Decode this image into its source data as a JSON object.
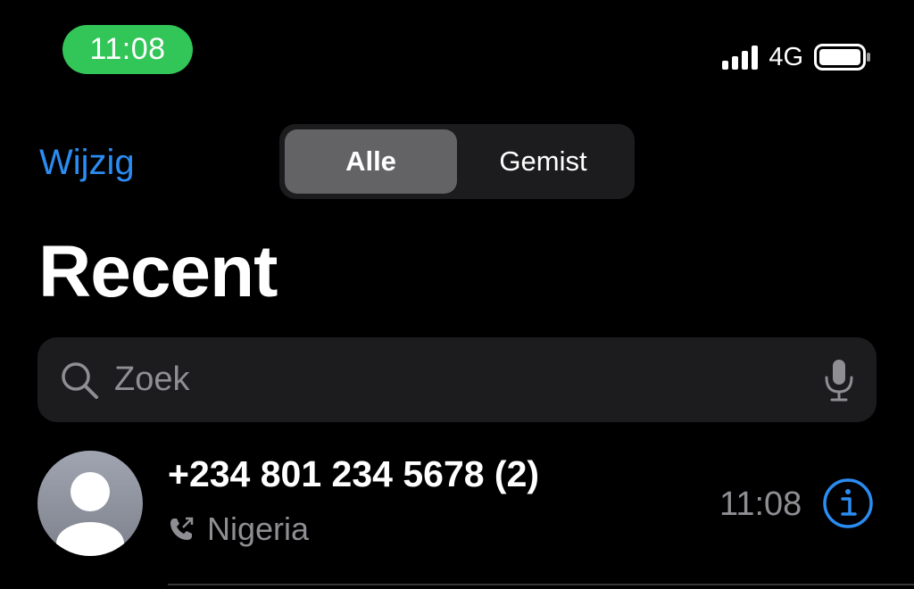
{
  "status_bar": {
    "time": "11:08",
    "network": "4G",
    "time_pill_color": "#32c659",
    "icons": [
      "signal-icon",
      "battery-icon"
    ]
  },
  "nav": {
    "edit_label": "Wijzig",
    "segments": [
      {
        "label": "Alle",
        "selected": true
      },
      {
        "label": "Gemist",
        "selected": false
      }
    ],
    "accent_color": "#2b8cf2"
  },
  "page": {
    "title": "Recent"
  },
  "search": {
    "placeholder": "Zoek",
    "value": "",
    "icons": [
      "search-icon",
      "microphone-icon"
    ]
  },
  "calls": [
    {
      "name": "+234 801 234 5678 (2)",
      "location": "Nigeria",
      "time": "11:08",
      "call_type_icon": "outgoing-call-icon",
      "info_icon": "info-icon"
    }
  ]
}
